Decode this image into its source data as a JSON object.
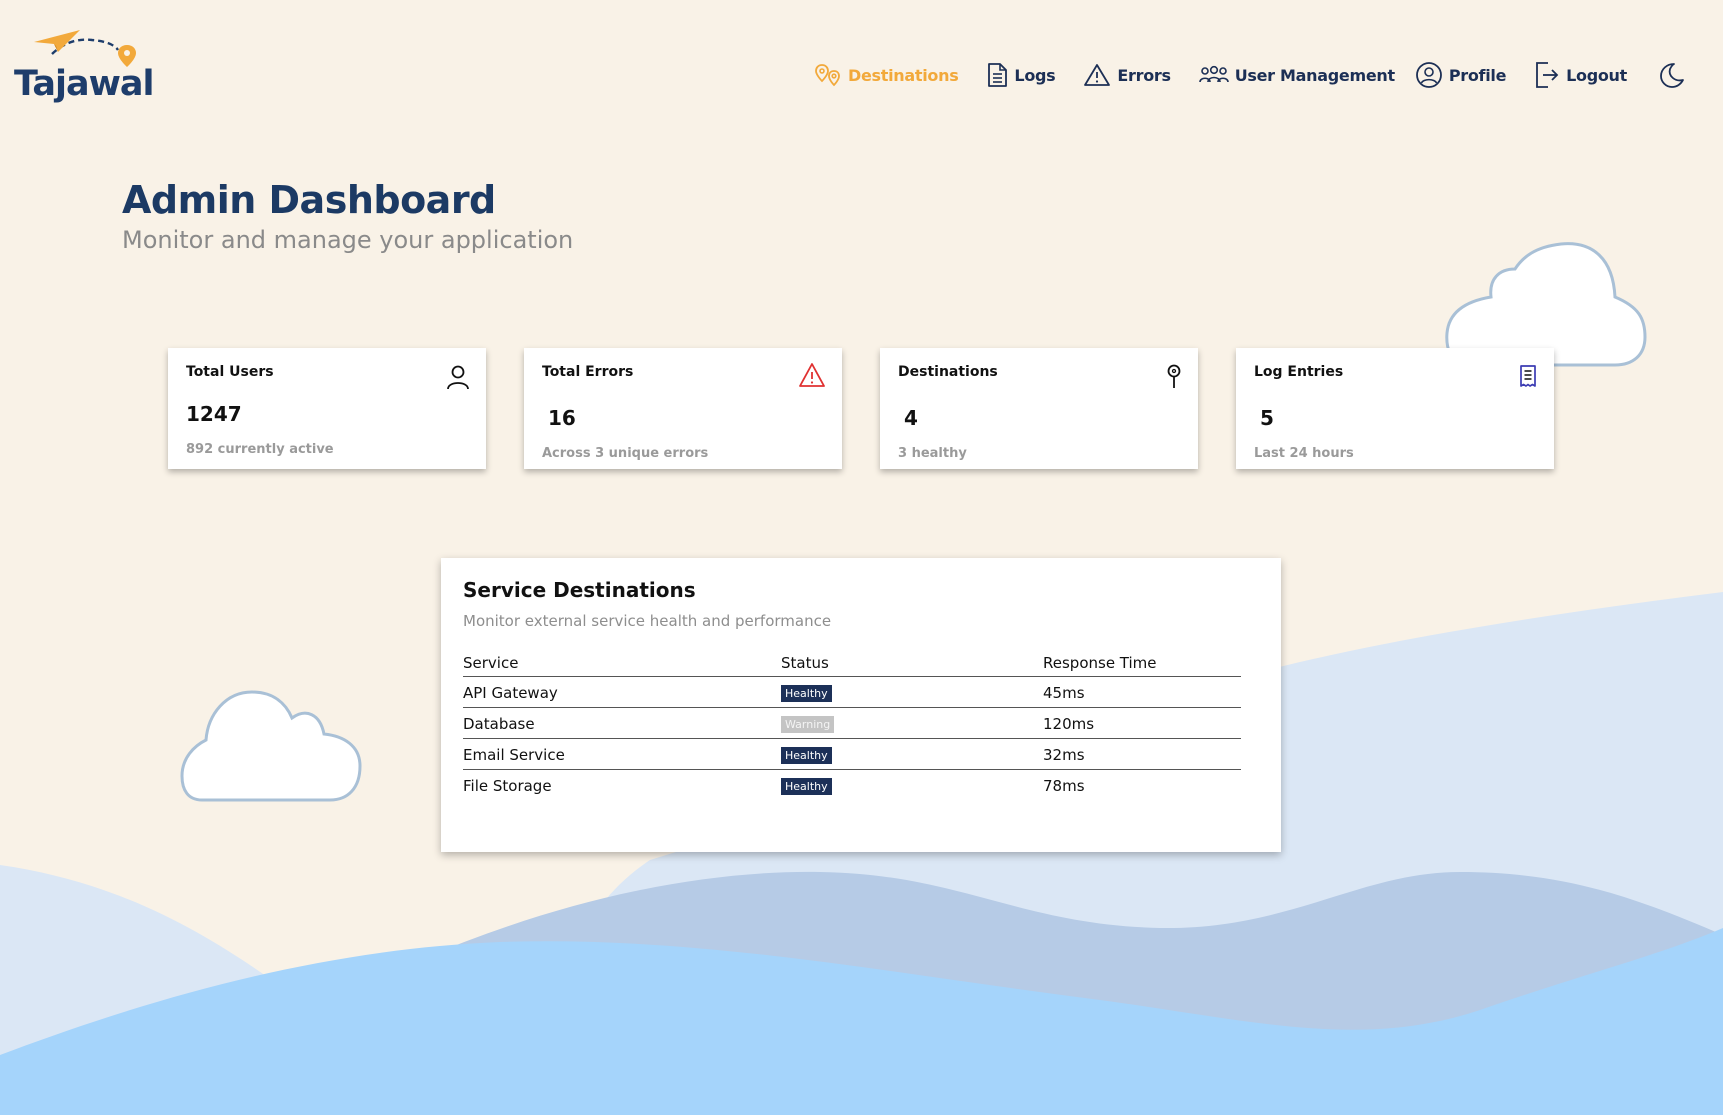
{
  "brand": {
    "name": "Tajawal",
    "accent": "#f2a93b",
    "navy": "#1c2f55"
  },
  "nav": {
    "items": [
      {
        "label": "Destinations",
        "icon": "map-pins-icon",
        "active": true
      },
      {
        "label": "Logs",
        "icon": "document-icon",
        "active": false
      },
      {
        "label": "Errors",
        "icon": "warning-triangle-icon",
        "active": false
      },
      {
        "label": "User Management",
        "icon": "users-icon",
        "active": false
      },
      {
        "label": "Profile",
        "icon": "user-circle-icon",
        "active": false
      },
      {
        "label": "Logout",
        "icon": "logout-icon",
        "active": false
      }
    ],
    "theme_toggle_icon": "moon-icon"
  },
  "header": {
    "title": "Admin Dashboard",
    "subtitle": "Monitor and manage your application"
  },
  "stats": [
    {
      "title": "Total Users",
      "value": "1247",
      "note": "892 currently active",
      "icon": "user-icon"
    },
    {
      "title": "Total Errors",
      "value": "16",
      "note": "Across 3 unique errors",
      "icon": "alert-triangle-icon",
      "icon_color": "#e03131"
    },
    {
      "title": "Destinations",
      "value": "4",
      "note": "3 healthy",
      "icon": "map-pin-icon"
    },
    {
      "title": "Log Entries",
      "value": "5",
      "note": "Last 24 hours",
      "icon": "receipt-icon",
      "icon_color": "#3b3bb3"
    }
  ],
  "service_destinations": {
    "title": "Service Destinations",
    "subtitle": "Monitor external service health and performance",
    "columns": [
      "Service",
      "Status",
      "Response Time"
    ],
    "rows": [
      {
        "service": "API Gateway",
        "status": "Healthy",
        "response_time": "45ms"
      },
      {
        "service": "Database",
        "status": "Warning",
        "response_time": "120ms"
      },
      {
        "service": "Email Service",
        "status": "Healthy",
        "response_time": "32ms"
      },
      {
        "service": "File Storage",
        "status": "Healthy",
        "response_time": "78ms"
      }
    ],
    "status_colors": {
      "Healthy": "#1c3058",
      "Warning": "#c4c4c4"
    }
  },
  "background_colors": {
    "page": "#f9f2e7",
    "wave_light": "#dbe7f5",
    "wave_mid": "#b6cbe6",
    "wave_front": "#a5d4fb"
  }
}
